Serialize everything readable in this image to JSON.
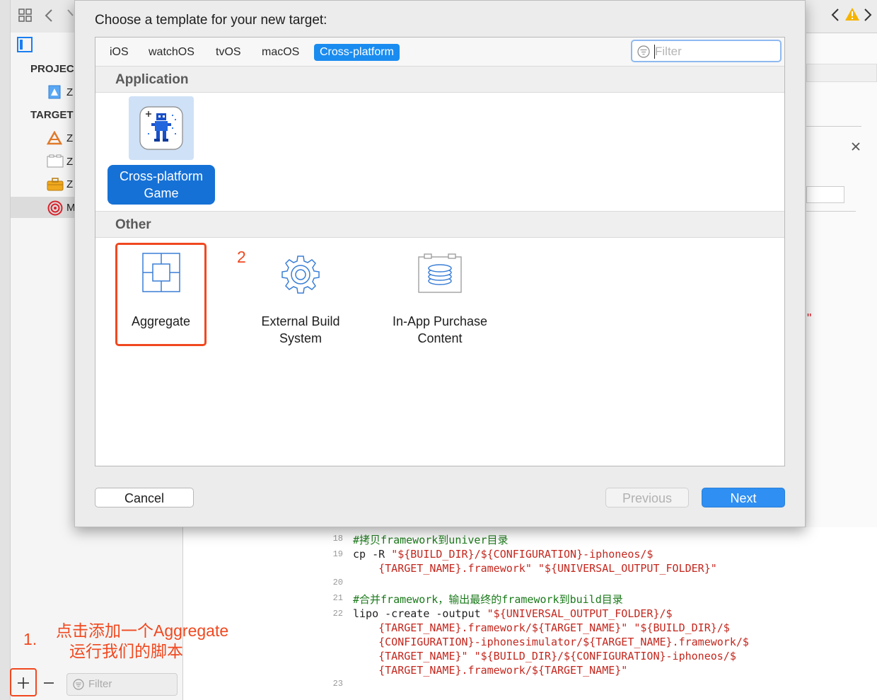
{
  "sheet": {
    "title": "Choose a template for your new target:",
    "tabs": [
      "iOS",
      "watchOS",
      "tvOS",
      "macOS",
      "Cross-platform"
    ],
    "active_tab": "Cross-platform",
    "filter_placeholder": "Filter",
    "groups": {
      "application": {
        "header": "Application",
        "templates": [
          {
            "label_line1": "Cross-platform",
            "label_line2": "Game",
            "icon": "game-sprite-icon",
            "selected": true
          }
        ]
      },
      "other": {
        "header": "Other",
        "templates": [
          {
            "label_line1": "Aggregate",
            "label_line2": "",
            "icon": "aggregate-icon"
          },
          {
            "label_line1": "External Build",
            "label_line2": "System",
            "icon": "gear-icon"
          },
          {
            "label_line1": "In-App Purchase",
            "label_line2": "Content",
            "icon": "purchase-content-icon"
          }
        ]
      }
    },
    "buttons": {
      "cancel": "Cancel",
      "previous": "Previous",
      "next": "Next"
    }
  },
  "sidebar": {
    "project_header": "PROJEC",
    "targets_header": "TARGET",
    "row_letters": [
      "Z",
      "Z",
      "Z",
      "Z",
      "M"
    ],
    "filter_placeholder": "Filter"
  },
  "editor": {
    "lines": [
      {
        "num": "18",
        "parts": [
          {
            "t": "#拷贝framework到univer目录",
            "c": "comment"
          }
        ]
      },
      {
        "num": "19",
        "parts": [
          {
            "t": "cp -R ",
            "c": "plain"
          },
          {
            "t": "\"${BUILD_DIR}/${CONFIGURATION}-iphoneos/$",
            "c": "string"
          }
        ]
      },
      {
        "num": "",
        "parts": [
          {
            "t": "    {TARGET_NAME}.framework\" \"${UNIVERSAL_OUTPUT_FOLDER}\"",
            "c": "string"
          }
        ]
      },
      {
        "num": "20",
        "parts": []
      },
      {
        "num": "21",
        "parts": [
          {
            "t": "#合并framework，输出最终的framework到build目录",
            "c": "comment"
          }
        ]
      },
      {
        "num": "22",
        "parts": [
          {
            "t": "lipo -create -output ",
            "c": "plain"
          },
          {
            "t": "\"${UNIVERSAL_OUTPUT_FOLDER}/$",
            "c": "string"
          }
        ]
      },
      {
        "num": "",
        "parts": [
          {
            "t": "    {TARGET_NAME}.framework/${TARGET_NAME}\" \"${BUILD_DIR}/$",
            "c": "string"
          }
        ]
      },
      {
        "num": "",
        "parts": [
          {
            "t": "    {CONFIGURATION}-iphonesimulator/${TARGET_NAME}.framework/$",
            "c": "string"
          }
        ]
      },
      {
        "num": "",
        "parts": [
          {
            "t": "    {TARGET_NAME}\" \"${BUILD_DIR}/${CONFIGURATION}-iphoneos/$",
            "c": "string"
          }
        ]
      },
      {
        "num": "",
        "parts": [
          {
            "t": "    {TARGET_NAME}.framework/${TARGET_NAME}\"",
            "c": "string"
          }
        ]
      },
      {
        "num": "23",
        "parts": []
      }
    ]
  },
  "annotations": {
    "step1_num": "1.",
    "step1_line1": "点击添加一个Aggregate",
    "step1_line2": "运行我们的脚本",
    "step2_num": "2",
    "right_mark": "\""
  },
  "colors": {
    "accent": "#1a8cf0",
    "annotation": "#f0481f",
    "comment": "#1b7a1b",
    "string": "#c4271e"
  }
}
